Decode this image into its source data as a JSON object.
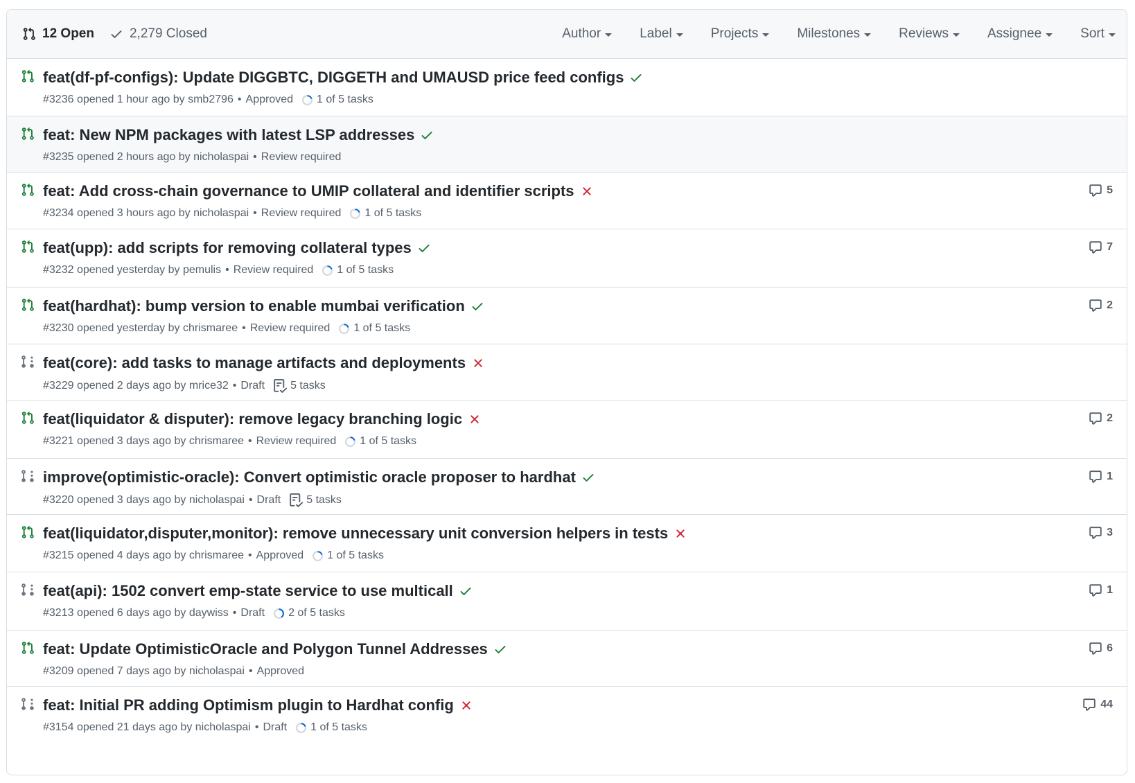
{
  "header": {
    "open_label": "12 Open",
    "closed_label": "2,279 Closed",
    "filters": [
      {
        "label": "Author"
      },
      {
        "label": "Label"
      },
      {
        "label": "Projects"
      },
      {
        "label": "Milestones"
      },
      {
        "label": "Reviews"
      },
      {
        "label": "Assignee"
      },
      {
        "label": "Sort"
      }
    ]
  },
  "colors": {
    "open_green": "#1a7f37",
    "draft_gray": "#6e7781",
    "check_green": "#1a7f37",
    "fail_red": "#cf222e",
    "progress_blue": "#0969da"
  },
  "prs": [
    {
      "title": "feat(df-pf-configs): Update DIGGBTC, DIGGETH and UMAUSD price feed configs",
      "status": "success",
      "kind": "open",
      "number": "#3236",
      "opened": "opened 1 hour ago by",
      "author": "smb2796",
      "review": "Approved",
      "task_type": "progress",
      "task_label": "1 of 5 tasks",
      "progress": 0.2,
      "comments": ""
    },
    {
      "title": "feat: New NPM packages with latest LSP addresses",
      "status": "success",
      "kind": "open",
      "number": "#3235",
      "opened": "opened 2 hours ago by",
      "author": "nicholaspai",
      "review": "Review required",
      "task_type": "none",
      "task_label": "",
      "progress": 0,
      "comments": ""
    },
    {
      "title": "feat: Add cross-chain governance to UMIP collateral and identifier scripts",
      "status": "failure",
      "kind": "open",
      "number": "#3234",
      "opened": "opened 3 hours ago by",
      "author": "nicholaspai",
      "review": "Review required",
      "task_type": "progress",
      "task_label": "1 of 5 tasks",
      "progress": 0.2,
      "comments": "5"
    },
    {
      "title": "feat(upp): add scripts for removing collateral types",
      "status": "success",
      "kind": "open",
      "number": "#3232",
      "opened": "opened yesterday by",
      "author": "pemulis",
      "review": "Review required",
      "task_type": "progress",
      "task_label": "1 of 5 tasks",
      "progress": 0.2,
      "comments": "7"
    },
    {
      "title": "feat(hardhat): bump version to enable mumbai verification",
      "status": "success",
      "kind": "open",
      "number": "#3230",
      "opened": "opened yesterday by",
      "author": "chrismaree",
      "review": "Review required",
      "task_type": "progress",
      "task_label": "1 of 5 tasks",
      "progress": 0.2,
      "comments": "2"
    },
    {
      "title": "feat(core): add tasks to manage artifacts and deployments",
      "status": "failure",
      "kind": "draft",
      "number": "#3229",
      "opened": "opened 2 days ago by",
      "author": "mrice32",
      "review": "Draft",
      "task_type": "list",
      "task_label": "5 tasks",
      "progress": 0,
      "comments": ""
    },
    {
      "title": "feat(liquidator & disputer): remove legacy branching logic",
      "status": "failure",
      "kind": "open",
      "number": "#3221",
      "opened": "opened 3 days ago by",
      "author": "chrismaree",
      "review": "Review required",
      "task_type": "progress",
      "task_label": "1 of 5 tasks",
      "progress": 0.2,
      "comments": "2"
    },
    {
      "title": "improve(optimistic-oracle): Convert optimistic oracle proposer to hardhat",
      "status": "success",
      "kind": "draft",
      "number": "#3220",
      "opened": "opened 3 days ago by",
      "author": "nicholaspai",
      "review": "Draft",
      "task_type": "list",
      "task_label": "5 tasks",
      "progress": 0,
      "comments": "1"
    },
    {
      "title": "feat(liquidator,disputer,monitor): remove unnecessary unit conversion helpers in tests",
      "status": "failure",
      "kind": "open",
      "number": "#3215",
      "opened": "opened 4 days ago by",
      "author": "chrismaree",
      "review": "Approved",
      "task_type": "progress",
      "task_label": "1 of 5 tasks",
      "progress": 0.2,
      "comments": "3"
    },
    {
      "title": "feat(api): 1502 convert emp-state service to use multicall",
      "status": "success",
      "kind": "draft",
      "number": "#3213",
      "opened": "opened 6 days ago by",
      "author": "daywiss",
      "review": "Draft",
      "task_type": "progress",
      "task_label": "2 of 5 tasks",
      "progress": 0.4,
      "comments": "1"
    },
    {
      "title": "feat: Update OptimisticOracle and Polygon Tunnel Addresses",
      "status": "success",
      "kind": "open",
      "number": "#3209",
      "opened": "opened 7 days ago by",
      "author": "nicholaspai",
      "review": "Approved",
      "task_type": "none",
      "task_label": "",
      "progress": 0,
      "comments": "6"
    },
    {
      "title": "feat: Initial PR adding Optimism plugin to Hardhat config",
      "status": "failure",
      "kind": "draft",
      "number": "#3154",
      "opened": "opened 21 days ago by",
      "author": "nicholaspai",
      "review": "Draft",
      "task_type": "progress",
      "task_label": "1 of 5 tasks",
      "progress": 0.2,
      "comments": "44"
    }
  ]
}
